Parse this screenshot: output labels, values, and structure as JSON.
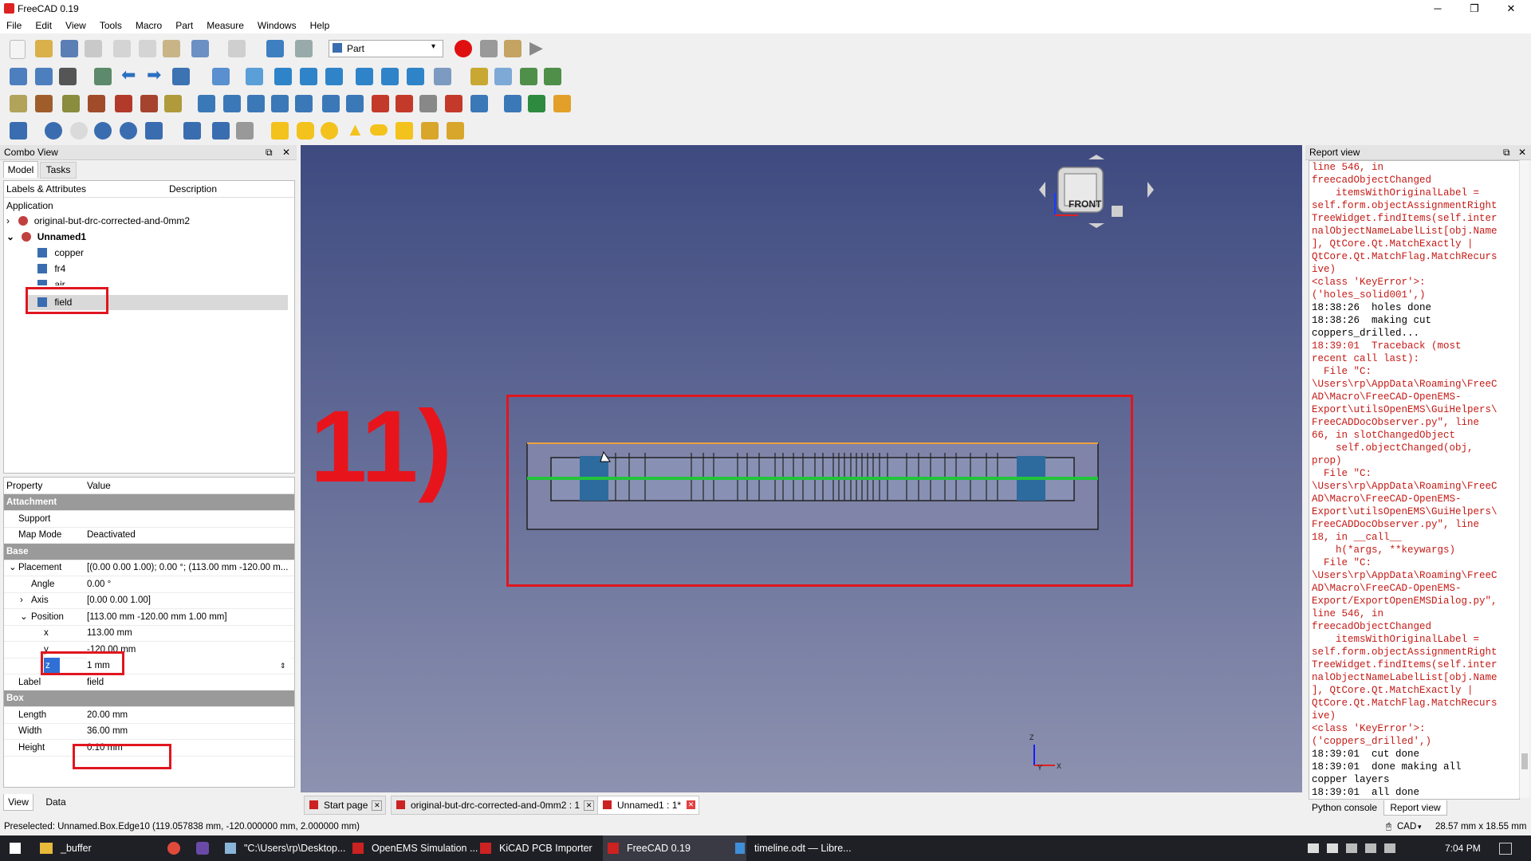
{
  "window": {
    "title": "FreeCAD 0.19",
    "minimize": "─",
    "maximize": "❐",
    "close": "✕"
  },
  "menu": [
    "File",
    "Edit",
    "View",
    "Tools",
    "Macro",
    "Part",
    "Measure",
    "Windows",
    "Help"
  ],
  "toolbar": {
    "workbench": "Part"
  },
  "combo_view": {
    "title": "Combo View",
    "tabs": [
      "Model",
      "Tasks"
    ],
    "tree_headers": [
      "Labels & Attributes",
      "Description"
    ],
    "tree_root": "Application",
    "tree_items": [
      {
        "label": "original-but-drc-corrected-and-0mm2"
      },
      {
        "label": "Unnamed1"
      },
      {
        "label": "copper"
      },
      {
        "label": "fr4"
      },
      {
        "label": "air"
      },
      {
        "label": "field"
      }
    ]
  },
  "property_editor": {
    "headers": [
      "Property",
      "Value"
    ],
    "rows": [
      {
        "kind": "group",
        "name": "Attachment",
        "value": ""
      },
      {
        "kind": "prop",
        "name": "Support",
        "value": ""
      },
      {
        "kind": "prop",
        "name": "Map Mode",
        "value": "Deactivated"
      },
      {
        "kind": "group",
        "name": "Base",
        "value": ""
      },
      {
        "kind": "prop",
        "name": "Placement",
        "value": "[(0.00 0.00 1.00); 0.00 °; (113.00 mm  -120.00 m..."
      },
      {
        "kind": "prop",
        "name": "Angle",
        "value": "0.00 °"
      },
      {
        "kind": "prop",
        "name": "Axis",
        "value": "[0.00 0.00 1.00]"
      },
      {
        "kind": "prop",
        "name": "Position",
        "value": "[113.00 mm  -120.00 mm  1.00 mm]"
      },
      {
        "kind": "prop",
        "name": "x",
        "value": "113.00 mm"
      },
      {
        "kind": "prop",
        "name": "y",
        "value": "-120.00 mm"
      },
      {
        "kind": "edit",
        "name": "z",
        "value": "1 mm"
      },
      {
        "kind": "prop",
        "name": "Label",
        "value": "field"
      },
      {
        "kind": "group",
        "name": "Box",
        "value": ""
      },
      {
        "kind": "prop",
        "name": "Length",
        "value": "20.00 mm"
      },
      {
        "kind": "prop",
        "name": "Width",
        "value": "36.00 mm"
      },
      {
        "kind": "prop",
        "name": "Height",
        "value": "0.10 mm"
      }
    ],
    "bottom_tabs": [
      "View",
      "Data"
    ]
  },
  "view3d": {
    "annotation": "11)",
    "navcube": "FRONT",
    "axis_z": "Z",
    "axis_y": "Y",
    "axis_x": "X"
  },
  "doc_tabs": [
    "Start page",
    "original-but-drc-corrected-and-0mm2 : 1",
    "Unnamed1 : 1*"
  ],
  "report_view": {
    "title": "Report view",
    "lines": [
      {
        "t": "line 546, in",
        "c": "err"
      },
      {
        "t": "freecadObjectChanged",
        "c": "err"
      },
      {
        "t": "    itemsWithOriginalLabel =",
        "c": "err"
      },
      {
        "t": "self.form.objectAssignmentRight",
        "c": "err"
      },
      {
        "t": "TreeWidget.findItems(self.inter",
        "c": "err"
      },
      {
        "t": "nalObjectNameLabelList[obj.Name",
        "c": "err"
      },
      {
        "t": "], QtCore.Qt.MatchExactly |",
        "c": "err"
      },
      {
        "t": "QtCore.Qt.MatchFlag.MatchRecurs",
        "c": "err"
      },
      {
        "t": "ive)",
        "c": "err"
      },
      {
        "t": "<class 'KeyError'>:",
        "c": "err"
      },
      {
        "t": "('holes_solid001',)",
        "c": "err"
      },
      {
        "t": "18:38:26  holes done",
        "c": "ok"
      },
      {
        "t": "18:38:26  making cut",
        "c": "ok"
      },
      {
        "t": "coppers_drilled...",
        "c": "ok"
      },
      {
        "t": "18:39:01  Traceback (most",
        "c": "err"
      },
      {
        "t": "recent call last):",
        "c": "err"
      },
      {
        "t": "  File \"C:",
        "c": "err"
      },
      {
        "t": "\\Users\\rp\\AppData\\Roaming\\FreeC",
        "c": "err"
      },
      {
        "t": "AD\\Macro\\FreeCAD-OpenEMS-",
        "c": "err"
      },
      {
        "t": "Export\\utilsOpenEMS\\GuiHelpers\\",
        "c": "err"
      },
      {
        "t": "FreeCADDocObserver.py\", line",
        "c": "err"
      },
      {
        "t": "66, in slotChangedObject",
        "c": "err"
      },
      {
        "t": "    self.objectChanged(obj,",
        "c": "err"
      },
      {
        "t": "prop)",
        "c": "err"
      },
      {
        "t": "  File \"C:",
        "c": "err"
      },
      {
        "t": "\\Users\\rp\\AppData\\Roaming\\FreeC",
        "c": "err"
      },
      {
        "t": "AD\\Macro\\FreeCAD-OpenEMS-",
        "c": "err"
      },
      {
        "t": "Export\\utilsOpenEMS\\GuiHelpers\\",
        "c": "err"
      },
      {
        "t": "FreeCADDocObserver.py\", line",
        "c": "err"
      },
      {
        "t": "18, in __call__",
        "c": "err"
      },
      {
        "t": "    h(*args, **keywargs)",
        "c": "err"
      },
      {
        "t": "  File \"C:",
        "c": "err"
      },
      {
        "t": "\\Users\\rp\\AppData\\Roaming\\FreeC",
        "c": "err"
      },
      {
        "t": "AD\\Macro\\FreeCAD-OpenEMS-",
        "c": "err"
      },
      {
        "t": "Export/ExportOpenEMSDialog.py\",",
        "c": "err"
      },
      {
        "t": "line 546, in",
        "c": "err"
      },
      {
        "t": "freecadObjectChanged",
        "c": "err"
      },
      {
        "t": "    itemsWithOriginalLabel =",
        "c": "err"
      },
      {
        "t": "self.form.objectAssignmentRight",
        "c": "err"
      },
      {
        "t": "TreeWidget.findItems(self.inter",
        "c": "err"
      },
      {
        "t": "nalObjectNameLabelList[obj.Name",
        "c": "err"
      },
      {
        "t": "], QtCore.Qt.MatchExactly |",
        "c": "err"
      },
      {
        "t": "QtCore.Qt.MatchFlag.MatchRecurs",
        "c": "err"
      },
      {
        "t": "ive)",
        "c": "err"
      },
      {
        "t": "<class 'KeyError'>:",
        "c": "err"
      },
      {
        "t": "('coppers_drilled',)",
        "c": "err"
      },
      {
        "t": "18:39:01  cut done",
        "c": "ok"
      },
      {
        "t": "18:39:01  done making all",
        "c": "ok"
      },
      {
        "t": "copper layers",
        "c": "ok"
      },
      {
        "t": "18:39:01  all done",
        "c": "ok"
      }
    ],
    "bottom_tabs": [
      "Python console",
      "Report view"
    ]
  },
  "statusbar": {
    "message": "Preselected: Unnamed.Box.Edge10 (119.057838 mm, -120.000000 mm, 2.000000 mm)",
    "nav_style": "CAD",
    "dimensions": "28.57 mm x 18.55 mm"
  },
  "taskbar": {
    "items": [
      "_buffer",
      "\"C:\\Users\\rp\\Desktop...",
      "OpenEMS Simulation ...",
      "KiCAD PCB Importer",
      "FreeCAD 0.19",
      "timeline.odt — Libre..."
    ],
    "time": "7:04 PM"
  },
  "colors": {
    "accent_red": "#e0161f",
    "viewport_top": "#3e4a80",
    "viewport_bottom": "#8d92b0",
    "error_text": "#c41a16"
  }
}
